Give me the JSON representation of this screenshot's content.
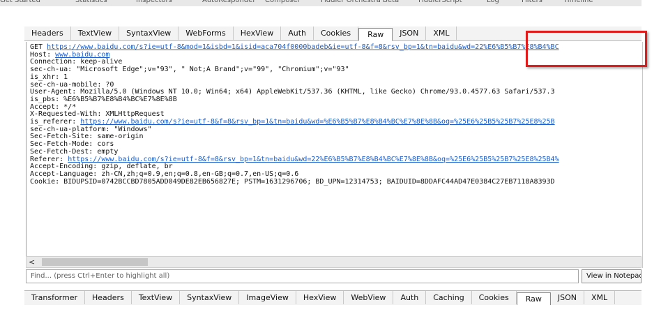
{
  "top_strip": [
    "Get Started",
    "Statistics",
    "Inspectors",
    "AutoResponder",
    "Composer",
    "Fiddler Orchestra Beta",
    "FiddlerScript",
    "Log",
    "Filters",
    "Timeline"
  ],
  "request_tabs": [
    "Headers",
    "TextView",
    "SyntaxView",
    "WebForms",
    "HexView",
    "Auth",
    "Cookies",
    "Raw",
    "JSON",
    "XML"
  ],
  "response_tabs": [
    "Transformer",
    "Headers",
    "TextView",
    "SyntaxView",
    "ImageView",
    "HexView",
    "WebView",
    "Auth",
    "Caching",
    "Cookies",
    "Raw",
    "JSON",
    "XML"
  ],
  "active_request_tab": "Raw",
  "active_response_tab": "Raw",
  "raw_lines": [
    {
      "label": "GET ",
      "link": "https://www.baidu.com/s?ie=utf-8&mod=1&isbd=1&isid=aca704f0000badeb&ie=utf-8&f=8&rsv_bp=1&tn=baidu&wd=22%E6%B5%B7%E8%B4%BC",
      "rest": ""
    },
    {
      "label": "Host: ",
      "link": "www.baidu.com",
      "rest": ""
    },
    {
      "label": "Connection: keep-alive",
      "link": "",
      "rest": ""
    },
    {
      "label": "sec-ch-ua: \"Microsoft Edge\";v=\"93\", \" Not;A Brand\";v=\"99\", \"Chromium\";v=\"93\"",
      "link": "",
      "rest": ""
    },
    {
      "label": "is_xhr: 1",
      "link": "",
      "rest": ""
    },
    {
      "label": "sec-ch-ua-mobile: ?0",
      "link": "",
      "rest": ""
    },
    {
      "label": "User-Agent: Mozilla/5.0 (Windows NT 10.0; Win64; x64) AppleWebKit/537.36 (KHTML, like Gecko) Chrome/93.0.4577.63 Safari/537.3",
      "link": "",
      "rest": ""
    },
    {
      "label": "is_pbs: %E6%B5%B7%E8%B4%BC%E7%8E%8B",
      "link": "",
      "rest": ""
    },
    {
      "label": "Accept: */*",
      "link": "",
      "rest": ""
    },
    {
      "label": "X-Requested-With: XMLHttpRequest",
      "link": "",
      "rest": ""
    },
    {
      "label": "is_referer: ",
      "link": "https://www.baidu.com/s?ie=utf-8&f=8&rsv_bp=1&tn=baidu&wd=%E6%B5%B7%E8%B4%BC%E7%8E%8B&oq=%25E6%25B5%25B7%25E8%25B",
      "rest": ""
    },
    {
      "label": "sec-ch-ua-platform: \"Windows\"",
      "link": "",
      "rest": ""
    },
    {
      "label": "Sec-Fetch-Site: same-origin",
      "link": "",
      "rest": ""
    },
    {
      "label": "Sec-Fetch-Mode: cors",
      "link": "",
      "rest": ""
    },
    {
      "label": "Sec-Fetch-Dest: empty",
      "link": "",
      "rest": ""
    },
    {
      "label": "Referer: ",
      "link": "https://www.baidu.com/s?ie=utf-8&f=8&rsv_bp=1&tn=baidu&wd=22%E6%B5%B7%E8%B4%BC%E7%8E%8B&oq=%25E6%25B5%25B7%25E8%25B4%",
      "rest": ""
    },
    {
      "label": "Accept-Encoding: gzip, deflate, br",
      "link": "",
      "rest": ""
    },
    {
      "label": "Accept-Language: zh-CN,zh;q=0.9,en;q=0.8,en-GB;q=0.7,en-US;q=0.6",
      "link": "",
      "rest": ""
    },
    {
      "label": "Cookie: BIDUPSID=0742BCCBD7805ADD049DE82EB656827E; PSTM=1631296706; BD_UPN=12314753; BAIDUID=8DDAFC44AD47E0384C27EB7118A8393D",
      "link": "",
      "rest": ""
    }
  ],
  "scrollbar": {
    "left_arrow": "<"
  },
  "find": {
    "placeholder": "Find... (press Ctrl+Enter to highlight all)",
    "button": "View in Notepad"
  },
  "colors": {
    "link": "#1a5cc8",
    "highlight_box": "#e01d1d",
    "tab_bar": "#f3f3f3"
  }
}
